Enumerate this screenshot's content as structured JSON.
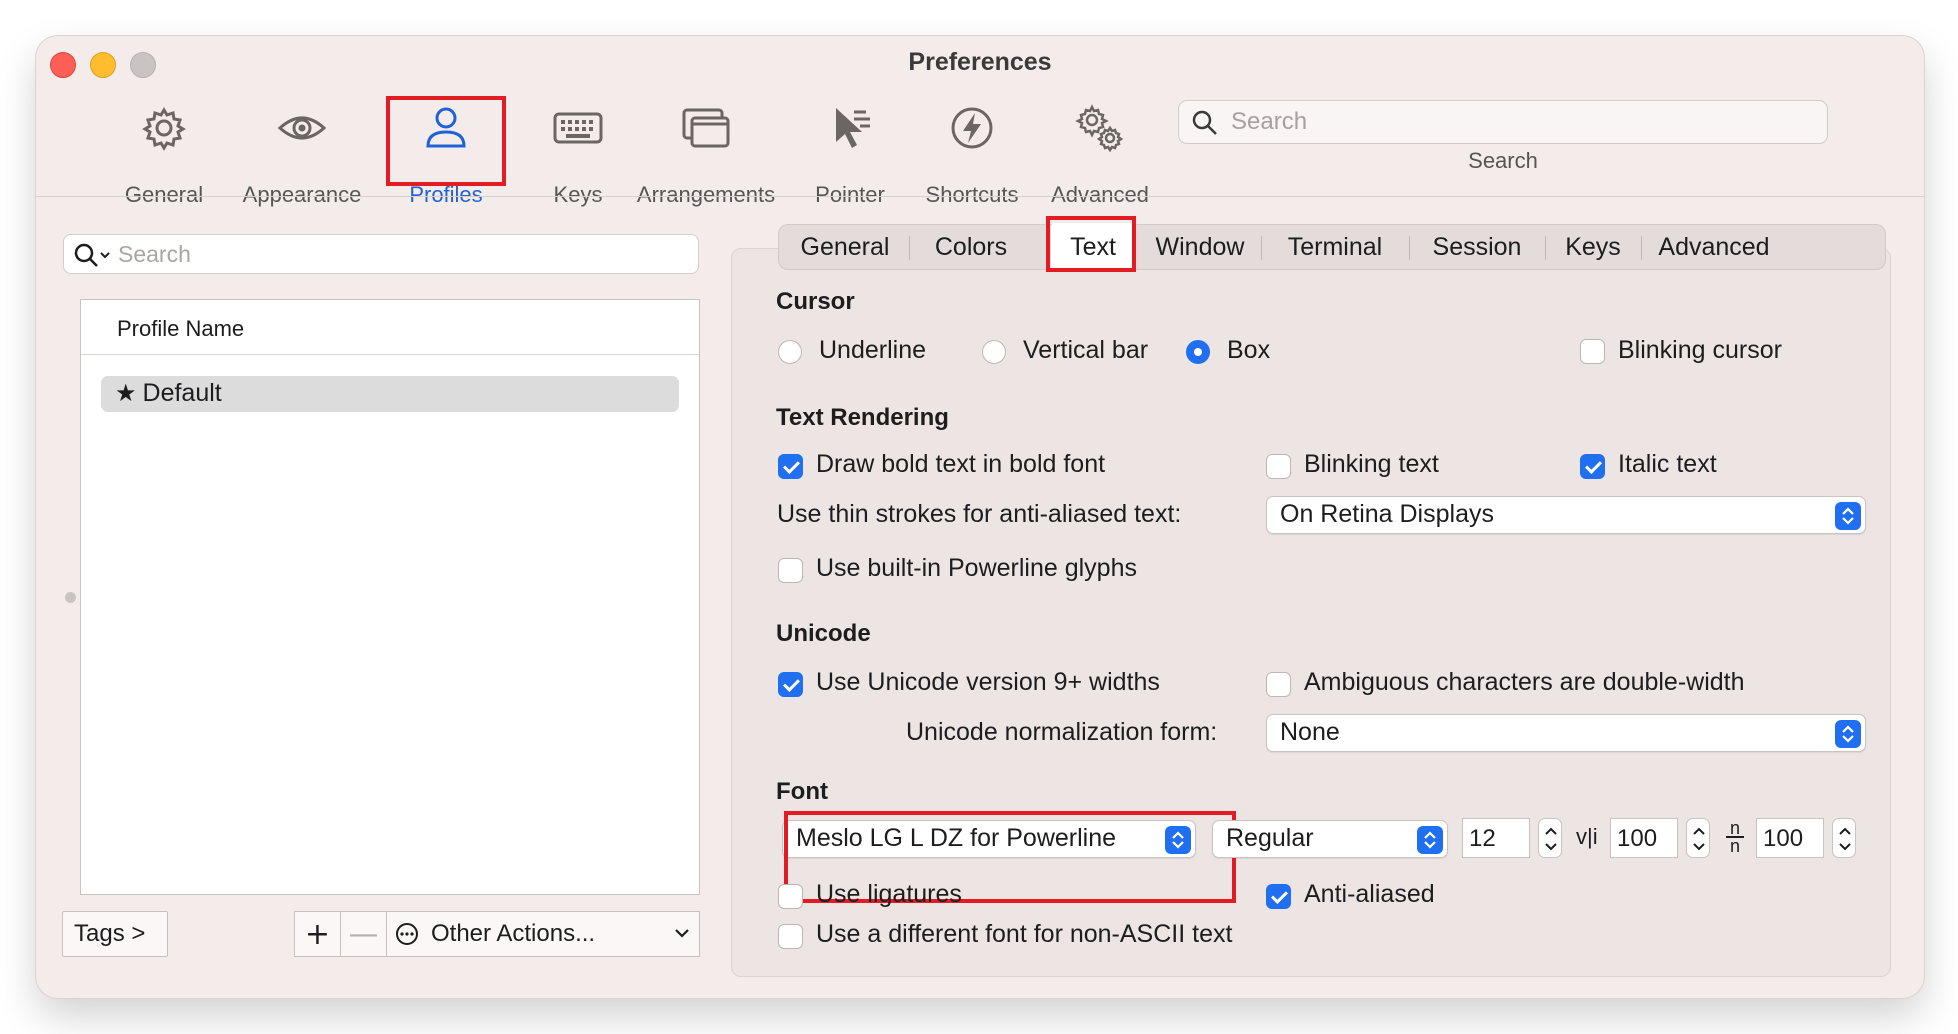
{
  "window": {
    "title": "Preferences"
  },
  "toolbar": {
    "items": [
      {
        "label": "General",
        "icon": "gear-icon"
      },
      {
        "label": "Appearance",
        "icon": "eye-icon"
      },
      {
        "label": "Profiles",
        "icon": "person-icon",
        "active": true
      },
      {
        "label": "Keys",
        "icon": "keyboard-icon"
      },
      {
        "label": "Arrangements",
        "icon": "windows-icon"
      },
      {
        "label": "Pointer",
        "icon": "pointer-icon"
      },
      {
        "label": "Shortcuts",
        "icon": "bolt-icon"
      },
      {
        "label": "Advanced",
        "icon": "gears-icon"
      }
    ],
    "search": {
      "placeholder": "Search",
      "label": "Search"
    }
  },
  "profiles": {
    "search_placeholder": "Search",
    "column_header": "Profile Name",
    "rows": [
      {
        "name": "Default",
        "star": "★"
      }
    ],
    "tags_button": "Tags >",
    "add_button": "+",
    "remove_button": "—",
    "other_actions": "Other Actions..."
  },
  "tabs": [
    "General",
    "Colors",
    "Text",
    "Window",
    "Terminal",
    "Session",
    "Keys",
    "Advanced"
  ],
  "active_tab": "Text",
  "cursor": {
    "heading": "Cursor",
    "options": [
      "Underline",
      "Vertical bar",
      "Box"
    ],
    "selected": "Box",
    "blinking_label": "Blinking cursor",
    "blinking": false
  },
  "text_rendering": {
    "heading": "Text Rendering",
    "bold_label": "Draw bold text in bold font",
    "bold": true,
    "blinking_text_label": "Blinking text",
    "blinking_text": false,
    "italic_label": "Italic text",
    "italic": true,
    "thin_strokes_label": "Use thin strokes for anti-aliased text:",
    "thin_strokes_value": "On Retina Displays",
    "powerline_label": "Use built-in Powerline glyphs",
    "powerline": false
  },
  "unicode": {
    "heading": "Unicode",
    "widths_label": "Use Unicode version 9+ widths",
    "widths": true,
    "ambiguous_label": "Ambiguous characters are double-width",
    "ambiguous": false,
    "normalization_label": "Unicode normalization form:",
    "normalization_value": "None"
  },
  "font": {
    "heading": "Font",
    "family": "Meslo LG L DZ for Powerline",
    "weight": "Regular",
    "size": "12",
    "v_spacing_label": "v|i",
    "v_spacing": "100",
    "h_spacing_top": "n",
    "h_spacing_bottom": "n",
    "h_spacing": "100",
    "ligatures_label": "Use ligatures",
    "ligatures": false,
    "antialiased_label": "Anti-aliased",
    "antialiased": true,
    "non_ascii_label": "Use a different font for non-ASCII text",
    "non_ascii": false
  },
  "colors": {
    "accent": "#1f6ff0",
    "highlight": "#e31b23",
    "active_tool": "#1f62d8"
  }
}
